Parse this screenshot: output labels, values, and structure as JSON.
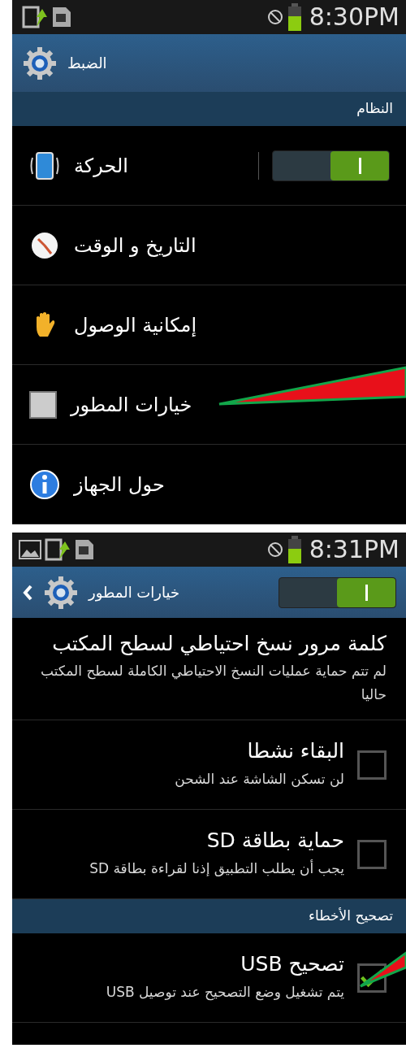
{
  "screens": [
    {
      "status_bar": {
        "time": "8:30PM",
        "image_notification": false
      },
      "header": {
        "title": "الضبط",
        "back": false
      },
      "sections": [
        {
          "title": "النظام",
          "items": [
            {
              "kind": "toggle",
              "title": "الحركة",
              "on": true
            },
            {
              "kind": "link",
              "title": "التاريخ و الوقت"
            },
            {
              "kind": "link",
              "title": "إمكانية الوصول"
            },
            {
              "kind": "link",
              "title": "خيارات المطور"
            },
            {
              "kind": "link",
              "title": "حول الجهاز"
            }
          ]
        }
      ]
    },
    {
      "status_bar": {
        "time": "8:31PM",
        "image_notification": true
      },
      "header": {
        "title": "خيارات المطور",
        "back": true,
        "toggle": {
          "on": true
        }
      },
      "sections": [
        {
          "items": [
            {
              "kind": "text",
              "title": "كلمة مرور نسخ احتياطي لسطح المكتب",
              "summary": "لم تتم حماية عمليات النسخ الاحتياطي الكاملة لسطح المكتب حاليا"
            },
            {
              "kind": "checkbox",
              "title": "البقاء نشطا",
              "summary": "لن تسكن الشاشة عند الشحن",
              "checked": false
            },
            {
              "kind": "checkbox",
              "title": "حماية بطاقة SD",
              "summary": "يجب أن يطلب التطبيق إذنا لقراءة بطاقة SD",
              "checked": false
            }
          ]
        },
        {
          "title": "تصحيح الأخطاء",
          "items": [
            {
              "kind": "checkbox",
              "title": "تصحيح USB",
              "summary": "يتم تشغيل وضع التصحيح عند توصيل USB",
              "checked": true
            }
          ]
        }
      ]
    }
  ]
}
